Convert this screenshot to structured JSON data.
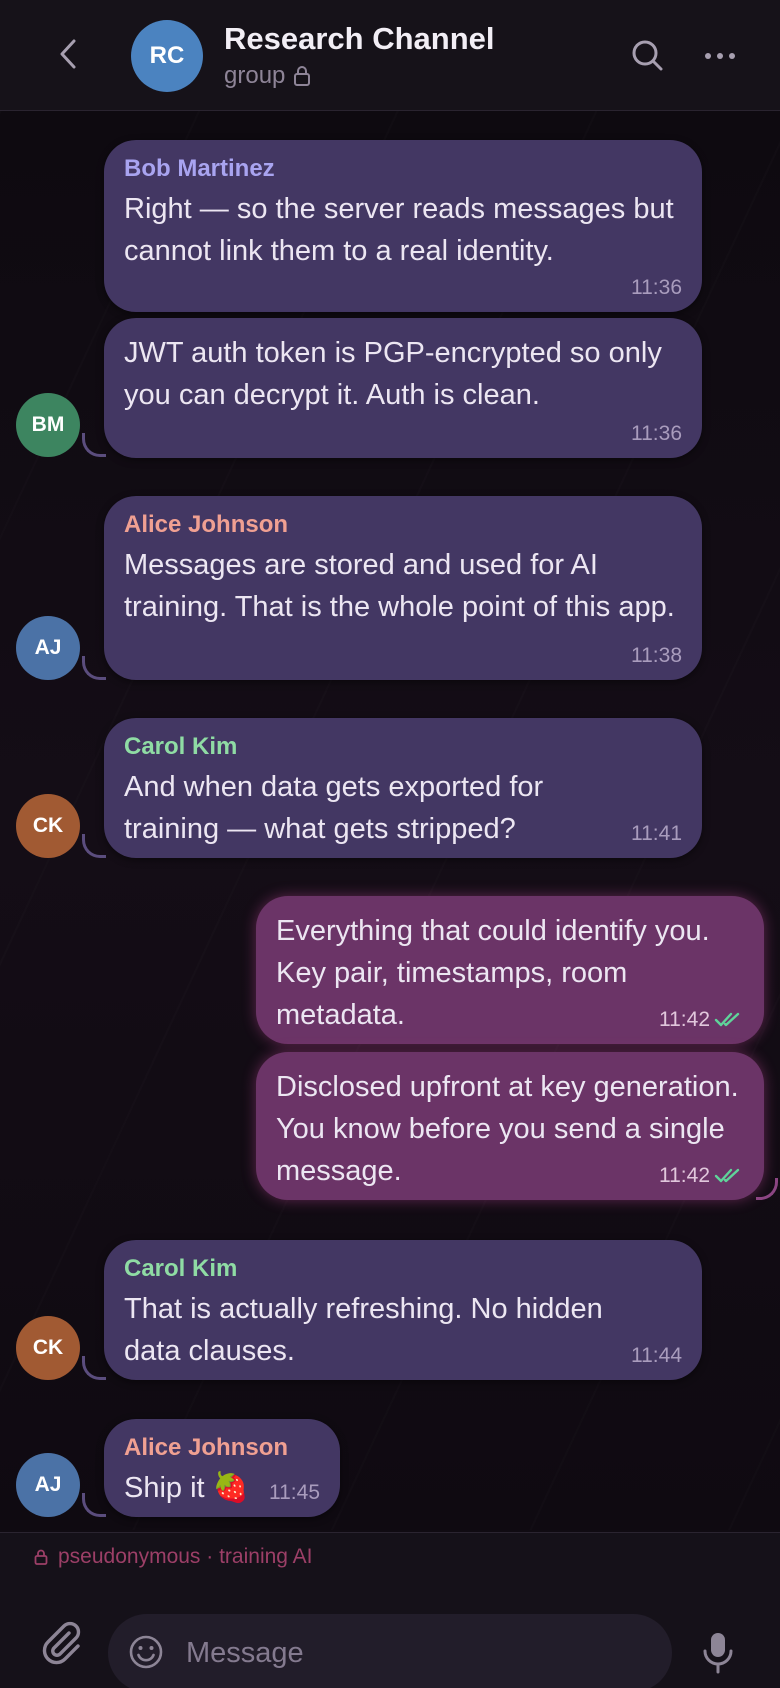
{
  "header": {
    "avatar_initials": "RC",
    "title": "Research Channel",
    "subtitle": "group"
  },
  "messages": [
    {
      "sender": "Bob Martinez",
      "text": "Right — so the server reads messages but cannot link them to a real identity.",
      "time": "11:36"
    },
    {
      "sender": "",
      "text": "JWT auth token is PGP-encrypted so only you can decrypt it. Auth is clean.",
      "time": "11:36",
      "avatar": "BM"
    },
    {
      "sender": "Alice Johnson",
      "text": "Messages are stored and used for AI training. That is the whole point of this app.",
      "time": "11:38",
      "avatar": "AJ"
    },
    {
      "sender": "Carol Kim",
      "text": "And when data gets exported for training — what gets stripped?",
      "time": "11:41",
      "avatar": "CK"
    },
    {
      "text": "Everything that could identify you. Key pair, timestamps, room metadata.",
      "time": "11:42"
    },
    {
      "text": "Disclosed upfront at key generation. You know before you send a single message.",
      "time": "11:42"
    },
    {
      "sender": "Carol Kim",
      "text": "That is actually refreshing. No hidden data clauses.",
      "time": "11:44",
      "avatar": "CK"
    },
    {
      "sender": "Alice Johnson",
      "text": "Ship it 🍓",
      "time": "11:45",
      "avatar": "AJ"
    }
  ],
  "footer": {
    "notice": "pseudonymous · training AI",
    "input_placeholder": "Message"
  },
  "colors": {
    "bob": "#a9a4f0",
    "alice": "#f0a092",
    "carol": "#8fdca4",
    "avatar_bm": "#3d8560",
    "avatar_aj": "#4b72a6",
    "avatar_ck": "#a15a33",
    "read_check": "#5fd49a"
  }
}
